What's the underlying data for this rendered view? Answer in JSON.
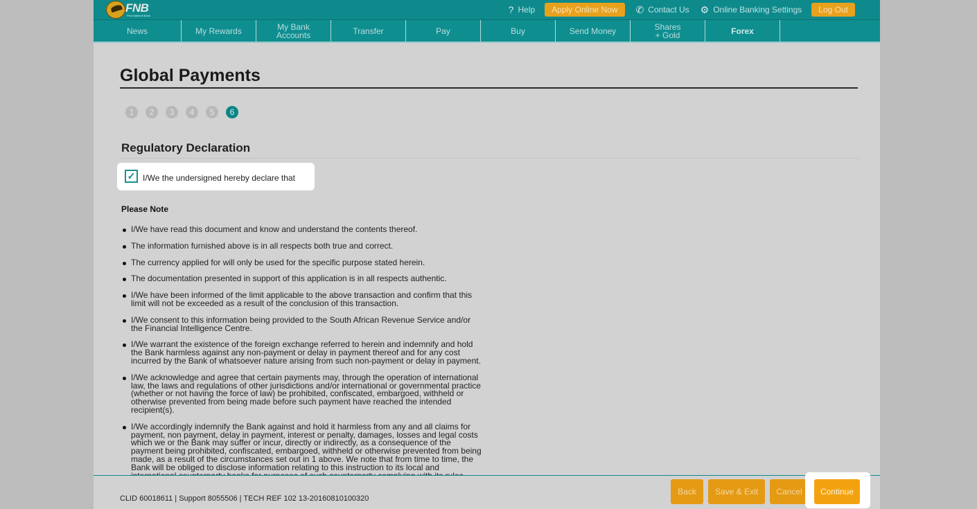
{
  "header": {
    "logo_text": "FNB",
    "logo_tagline": "First National Bank",
    "links": {
      "help": "Help",
      "apply": "Apply Online Now",
      "contact": "Contact Us",
      "settings": "Online Banking Settings",
      "logout": "Log Out"
    },
    "icons": {
      "help": "question-icon",
      "contact": "phone-icon",
      "settings": "gear-icon"
    }
  },
  "nav": {
    "items": [
      "News",
      "My Rewards",
      "My Bank Accounts",
      "Transfer",
      "Pay",
      "Buy",
      "Send Money",
      "Shares + Gold",
      "Forex"
    ],
    "active": "Forex"
  },
  "page": {
    "title": "Global Payments",
    "steps": [
      "1",
      "2",
      "3",
      "4",
      "5",
      "6"
    ],
    "current_step": "6",
    "section_title": "Regulatory Declaration",
    "declaration_checked": true,
    "declaration_text": "I/We the undersigned hereby declare that",
    "note_title": "Please Note",
    "notes": [
      "I/We have read this document and know and understand the contents thereof.",
      "The information furnished above is in all respects both true and correct.",
      "The currency applied for will only be used for the specific purpose stated herein.",
      "The documentation presented in support of this application is in all respects authentic.",
      "I/We have been informed of the limit applicable to the above transaction and confirm that this limit will not be exceeded as a result of the conclusion of this transaction.",
      "I/We consent to this information being provided to the South African Revenue Service and/or the Financial Intelligence Centre.",
      "I/We warrant the existence of the foreign exchange referred to herein and indemnify and hold the Bank harmless against any non-payment or delay in payment thereof and for any cost incurred by the Bank of whatsoever nature arising from such non-payment or delay in payment.",
      "I/We acknowledge and agree that certain payments may, through the operation of international law, the laws and regulations of other jurisdictions and/or international or governmental practice (whether or not having the force of law) be prohibited, confiscated, embargoed, withheld or otherwise prevented from being made before such payment have reached the intended recipient(s).",
      "I/We accordingly indemnify the Bank against and hold it harmless from any and all claims for payment, non payment, delay in payment, interest or penalty, damages, losses and legal costs which we or the Bank may suffer or incur, directly or indirectly, as a consequence of the payment being prohibited, confiscated, embargoed, withheld or otherwise prevented from being made, as a result of the circumstances set out in 1 above. We note that from time to time, the Bank will be obliged to disclose information relating to this instruction to its local and international counterparty banks for purposes of such counterparty complying with its rules."
    ]
  },
  "footer": {
    "info": "CLID 60018611 | Support 8055506 | TECH REF 102 13-20160810100320",
    "buttons": {
      "back": "Back",
      "save_exit": "Save & Exit",
      "cancel": "Cancel",
      "continue": "Continue"
    }
  },
  "colors": {
    "brand_teal": "#0e8a8c",
    "accent_orange": "#e8a11d"
  }
}
